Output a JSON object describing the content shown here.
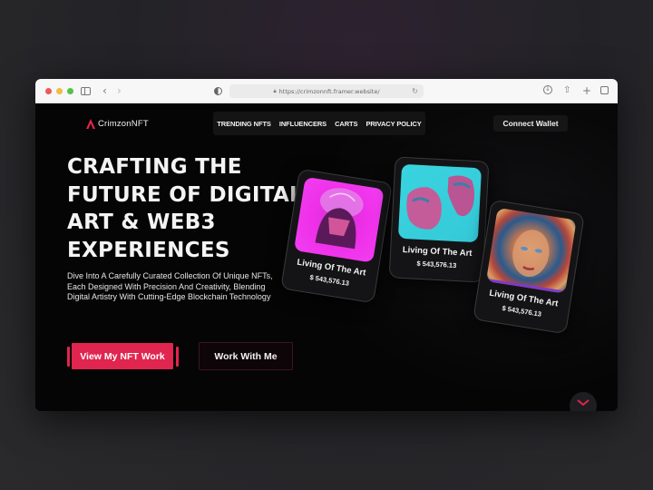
{
  "browser": {
    "url": "https://crimzonnft.framer.website/",
    "icons": [
      "close",
      "minimize",
      "zoom",
      "sidebar-icon",
      "back-icon",
      "forward-icon",
      "shield-icon",
      "lock-icon",
      "reload-icon",
      "download-icon",
      "share-icon",
      "new-tab-icon",
      "tabs-overview-icon"
    ]
  },
  "header": {
    "logo_text": "CrimzonNFT",
    "nav": [
      "TRENDING NFTS",
      "INFLUENCERS",
      "CARTS",
      "PRIVACY POLICY"
    ],
    "connect_label": "Connect Wallet"
  },
  "hero": {
    "title_lines": [
      "CRAFTING THE",
      "FUTURE OF DIGITAL",
      "ART & WEB3",
      "EXPERIENCES"
    ],
    "description": "Dive Into A Carefully Curated Collection Of Unique NFTs, Each Designed With Precision And Creativity, Blending Digital Artistry With Cutting-Edge Blockchain Technology",
    "primary_button": "View My NFT Work",
    "secondary_button": "Work With Me"
  },
  "cards": [
    {
      "title": "Living Of The Art",
      "price": "$ 543,576.13",
      "art": "pink-helmet-art"
    },
    {
      "title": "Living Of The Art",
      "price": "$ 543,576.13",
      "art": "cyan-faces-art"
    },
    {
      "title": "Living Of The Art",
      "price": "$ 543,576.13",
      "art": "woman-portrait-art"
    }
  ],
  "colors": {
    "accent": "#e0254e",
    "background": "#050505",
    "card_bg": "#141416"
  }
}
